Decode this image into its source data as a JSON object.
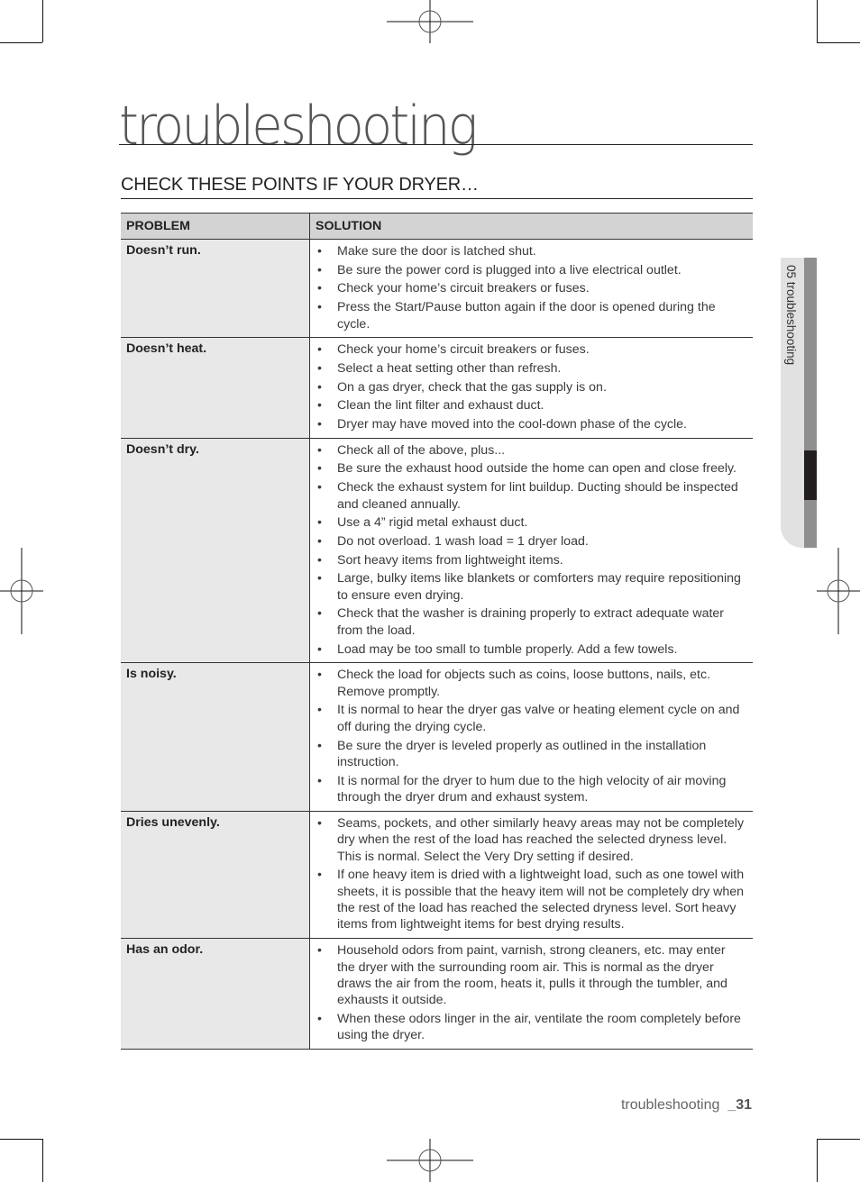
{
  "page": {
    "title": "troubleshooting",
    "section_heading": "CHECK THESE POINTS IF YOUR DRYER…",
    "side_tab_label": "05 troubleshooting",
    "footer": {
      "section": "troubleshooting",
      "page_number": "_31"
    }
  },
  "table": {
    "headers": {
      "problem": "PROBLEM",
      "solution": "SOLUTION"
    },
    "bullet_symbol": "•",
    "rows": [
      {
        "problem": "Doesn’t run.",
        "solutions": [
          "Make sure the door is latched shut.",
          "Be sure the power cord is plugged into a live electrical outlet.",
          "Check your home’s circuit breakers or fuses.",
          "Press the Start/Pause button again if the door is opened during the cycle."
        ]
      },
      {
        "problem": "Doesn’t heat.",
        "solutions": [
          "Check your home’s circuit breakers or fuses.",
          "Select a heat setting other than refresh.",
          "On a gas dryer, check that the gas supply is on.",
          "Clean the lint filter and exhaust duct.",
          "Dryer may have moved into the cool-down phase of the cycle."
        ]
      },
      {
        "problem": "Doesn’t dry.",
        "solutions": [
          "Check all of the above, plus...",
          "Be sure the exhaust hood outside the home can open and close freely.",
          "Check the exhaust system for lint buildup. Ducting should be inspected and cleaned annually.",
          "Use a 4” rigid metal exhaust duct.",
          "Do not overload. 1 wash load = 1 dryer load.",
          "Sort heavy items from lightweight items.",
          "Large, bulky items like blankets or comforters may require repositioning to ensure even drying.",
          "Check that the washer is draining properly to extract adequate water from the load.",
          "Load may be too small to tumble properly. Add a few towels."
        ]
      },
      {
        "problem": "Is noisy.",
        "solutions": [
          "Check the load for objects such as coins, loose buttons, nails, etc. Remove promptly.",
          "It is normal to hear the dryer gas valve or heating element cycle on and off during the drying cycle.",
          "Be sure the dryer is leveled properly as outlined in the installation instruction.",
          "It is normal for the dryer to hum due to the high velocity of air moving through the dryer drum and exhaust system."
        ]
      },
      {
        "problem": "Dries unevenly.",
        "solutions": [
          "Seams, pockets, and other similarly heavy areas may not be completely dry when the rest of the load has reached the selected dryness level. This is normal. Select the Very Dry setting if desired.",
          "If one heavy item is dried with a lightweight load, such as one towel with sheets, it is possible that the heavy item will not be completely dry when the rest of the load has reached the selected dryness level. Sort heavy items from lightweight items for best drying results."
        ]
      },
      {
        "problem": "Has an odor.",
        "solutions": [
          "Household odors from paint, varnish, strong cleaners, etc. may enter the dryer with the surrounding room air. This is normal as the dryer draws the air from the room, heats it, pulls it through the tumbler, and exhausts it outside.",
          "When these odors linger in the air, ventilate the room completely before using the dryer."
        ]
      }
    ]
  }
}
